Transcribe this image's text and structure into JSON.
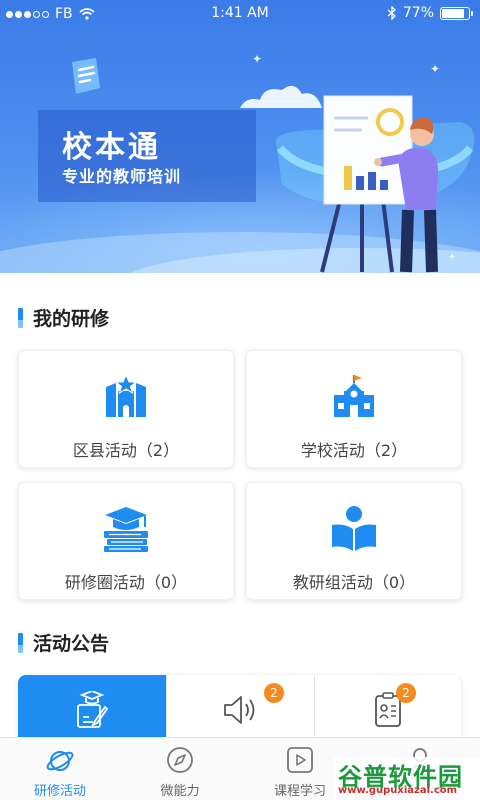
{
  "status_bar": {
    "carrier": "FB",
    "time": "1:41 AM",
    "battery": "77%",
    "battery_level": 0.77
  },
  "banner": {
    "title": "校本通",
    "subtitle": "专业的教师培训"
  },
  "my_study": {
    "title": "我的研修",
    "cards": [
      {
        "label": "区县活动（2）",
        "icon": "county-building-icon"
      },
      {
        "label": "学校活动（2）",
        "icon": "school-icon"
      },
      {
        "label": "研修圈活动（0）",
        "icon": "graduation-books-icon"
      },
      {
        "label": "教研组活动（0）",
        "icon": "reader-icon"
      }
    ]
  },
  "announcements": {
    "title": "活动公告",
    "tabs": [
      {
        "icon": "certificate-edit-icon",
        "badge": ""
      },
      {
        "icon": "speaker-icon",
        "badge": "2"
      },
      {
        "icon": "clipboard-person-icon",
        "badge": "2"
      }
    ]
  },
  "bottom_nav": {
    "items": [
      {
        "label": "研修活动",
        "icon": "planet-icon",
        "active": true
      },
      {
        "label": "微能力",
        "icon": "compass-icon",
        "active": false
      },
      {
        "label": "课程学习",
        "icon": "play-icon",
        "active": false
      },
      {
        "label": "",
        "icon": "profile-icon",
        "active": false
      }
    ]
  },
  "watermark": {
    "name": "谷普软件园",
    "url": "www.gupuxiazai.com"
  },
  "colors": {
    "primary": "#1e8cf0",
    "badge": "#f58a1e",
    "banner": "#3b7be8"
  }
}
